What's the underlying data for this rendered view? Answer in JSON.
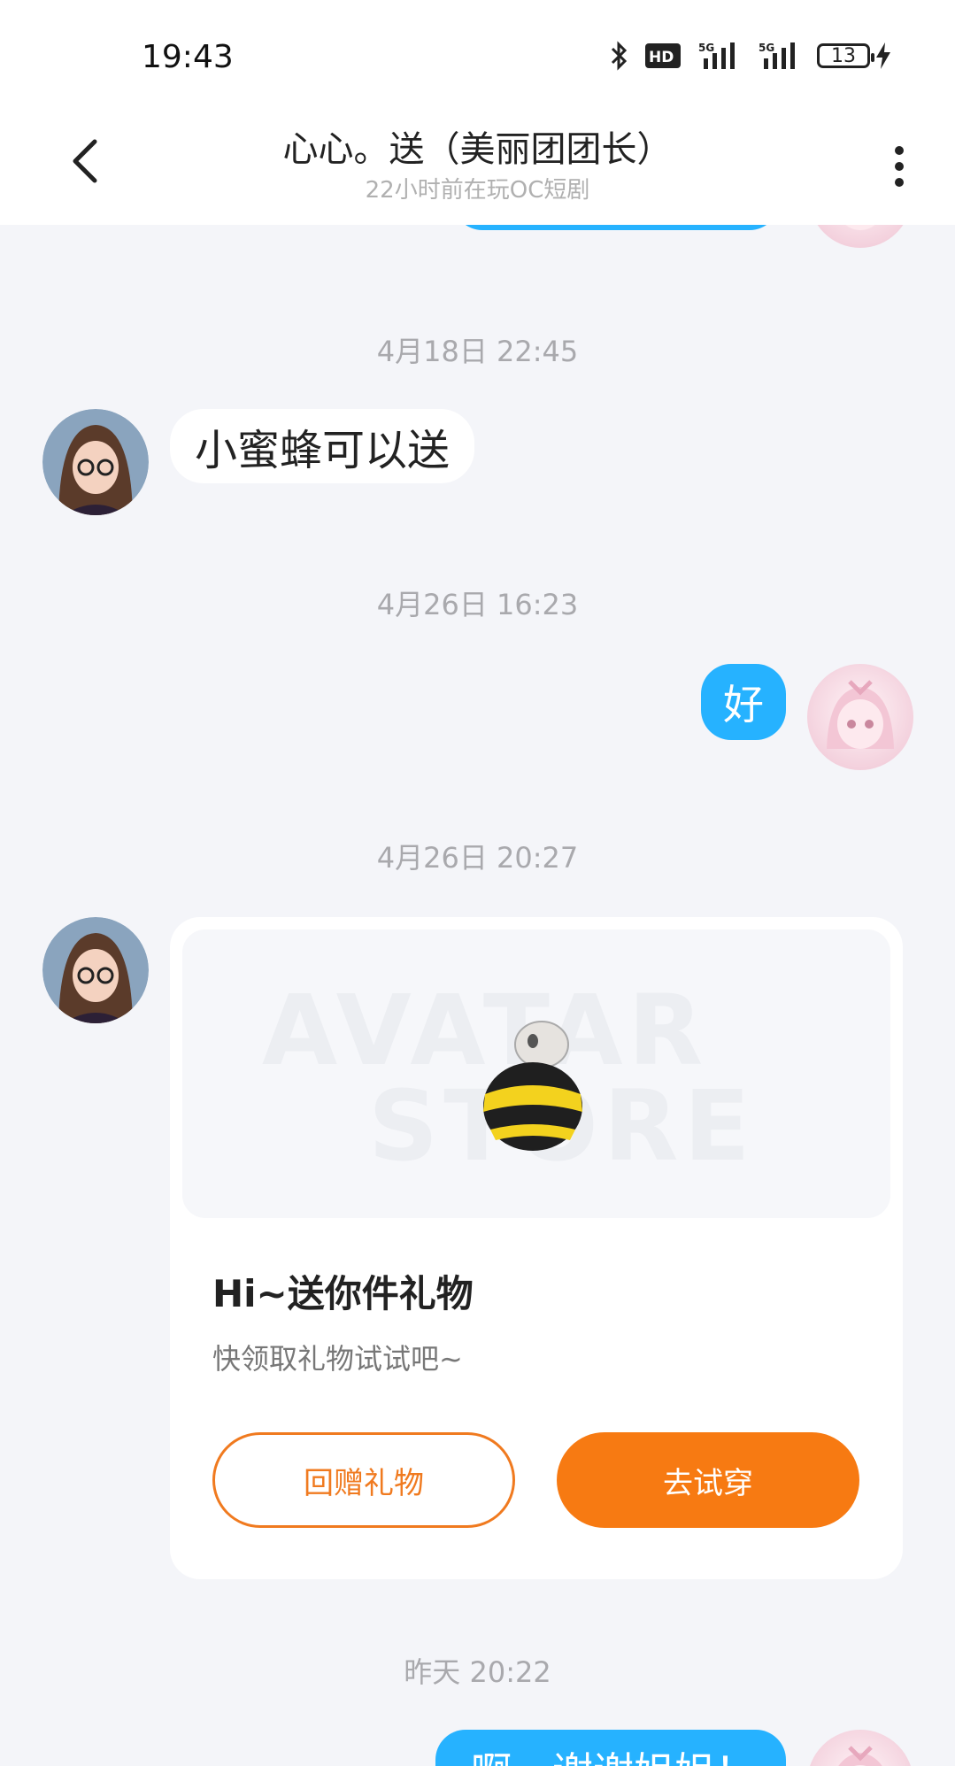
{
  "status_bar": {
    "time": "19:43",
    "battery": "13",
    "icons": [
      "bluetooth-icon",
      "hd-icon",
      "signal-5g-icon",
      "signal-5g-icon",
      "battery-icon",
      "charging-icon"
    ]
  },
  "header": {
    "title": "心心。送（美丽团团长）",
    "subtitle": "22小时前在玩OC短剧",
    "back_icon": "chevron-left-icon",
    "more_icon": "more-vertical-icon"
  },
  "messages": [
    {
      "type": "timestamp",
      "text": "4月18日 22:45"
    },
    {
      "type": "incoming",
      "text": "小蜜蜂可以送"
    },
    {
      "type": "timestamp",
      "text": "4月26日 16:23"
    },
    {
      "type": "outgoing",
      "text": "好"
    },
    {
      "type": "timestamp",
      "text": "4月26日 20:27"
    },
    {
      "type": "gift_card",
      "watermark_line1": "AVATAR",
      "watermark_line2": "STORE",
      "title": "Hi~送你件礼物",
      "subtitle": "快领取礼物试试吧~",
      "return_gift_label": "回赠礼物",
      "try_on_label": "去试穿"
    },
    {
      "type": "timestamp",
      "text": "昨天 20:22"
    },
    {
      "type": "outgoing",
      "text": "啊，谢谢姐姐！"
    }
  ],
  "colors": {
    "background": "#f4f5f9",
    "outgoing_bubble": "#26b2ff",
    "accent_orange": "#f77a12"
  }
}
